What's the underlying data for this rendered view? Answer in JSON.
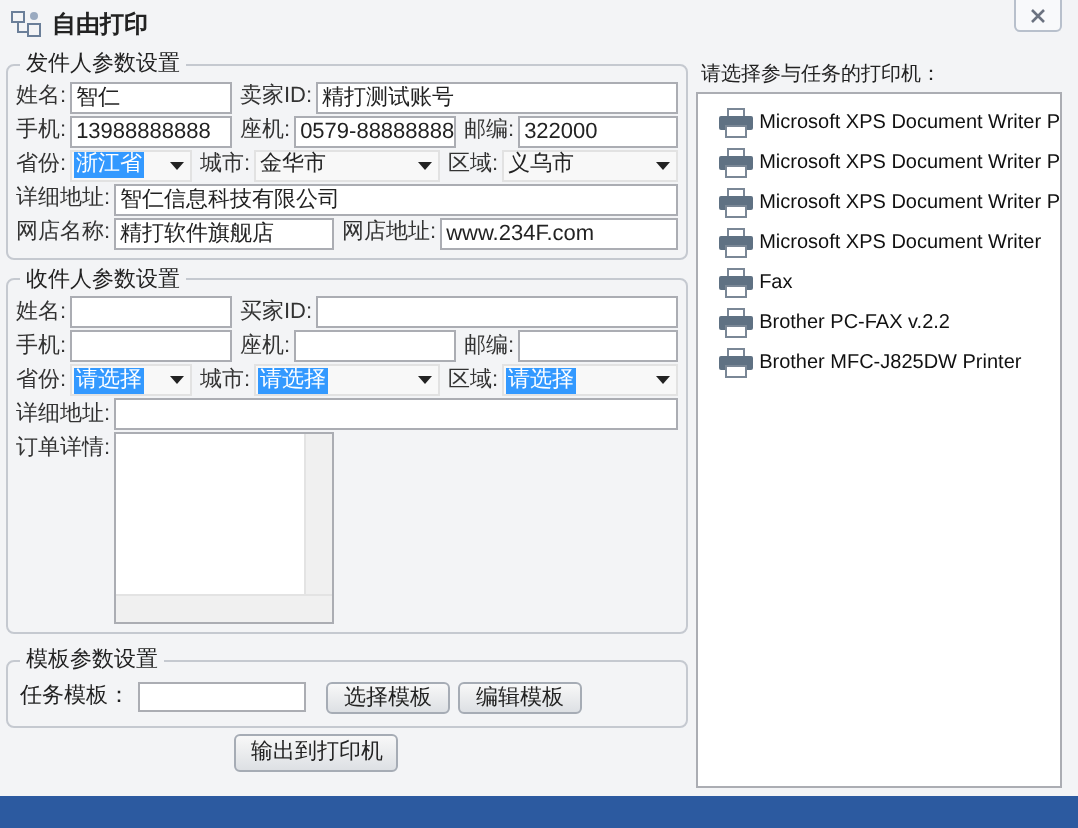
{
  "window": {
    "title": "自由打印"
  },
  "sender": {
    "title": "发件人参数设置",
    "rows": [
      [
        {
          "kind": "input",
          "label": "姓名:",
          "value": "智仁"
        },
        {
          "kind": "input",
          "label": "卖家ID:",
          "value": "精打测试账号"
        }
      ],
      [
        {
          "kind": "input",
          "label": "手机:",
          "value": "13988888888"
        },
        {
          "kind": "input",
          "label": "座机:",
          "value": "0579-88888888"
        },
        {
          "kind": "input",
          "label": "邮编:",
          "value": "322000"
        }
      ],
      [
        {
          "kind": "select",
          "label": "省份:",
          "value": "浙江省",
          "highlighted": true
        },
        {
          "kind": "select",
          "label": "城市:",
          "value": "金华市",
          "highlighted": false
        },
        {
          "kind": "select",
          "label": "区域:",
          "value": "义乌市",
          "highlighted": false
        }
      ],
      [
        {
          "kind": "input",
          "label": "详细地址:",
          "value": "智仁信息科技有限公司"
        }
      ],
      [
        {
          "kind": "input",
          "label": "网店名称:",
          "value": "精打软件旗舰店"
        },
        {
          "kind": "input",
          "label": "网店地址:",
          "value": "www.234F.com"
        }
      ]
    ]
  },
  "recipient": {
    "title": "收件人参数设置",
    "rows": [
      [
        {
          "kind": "input",
          "label": "姓名:"
        },
        {
          "kind": "input",
          "label": "买家ID:"
        }
      ],
      [
        {
          "kind": "input",
          "label": "手机:"
        },
        {
          "kind": "input",
          "label": "座机:"
        },
        {
          "kind": "input",
          "label": "邮编:"
        }
      ],
      [
        {
          "kind": "select",
          "label": "省份:",
          "value": "请选择",
          "highlighted": true
        },
        {
          "kind": "select",
          "label": "城市:",
          "value": "请选择",
          "highlighted": true
        },
        {
          "kind": "select",
          "label": "区域:",
          "value": "请选择",
          "highlighted": true
        }
      ],
      [
        {
          "kind": "input",
          "label": "详细地址:"
        }
      ],
      [
        {
          "kind": "textarea",
          "label": "订单详情:"
        }
      ]
    ]
  },
  "template": {
    "title": "模板参数设置",
    "field_label": "任务模板：",
    "buttons": [
      "选择模板",
      "编辑模板"
    ]
  },
  "output_button": "输出到打印机",
  "printers": {
    "label": "请选择参与任务的打印机：",
    "items": [
      "Microsoft XPS Document Writer P",
      "Microsoft XPS Document Writer P",
      "Microsoft XPS Document Writer P",
      "Microsoft XPS Document Writer",
      "Fax",
      "Brother PC-FAX v.2.2",
      "Brother MFC-J825DW Printer"
    ]
  }
}
